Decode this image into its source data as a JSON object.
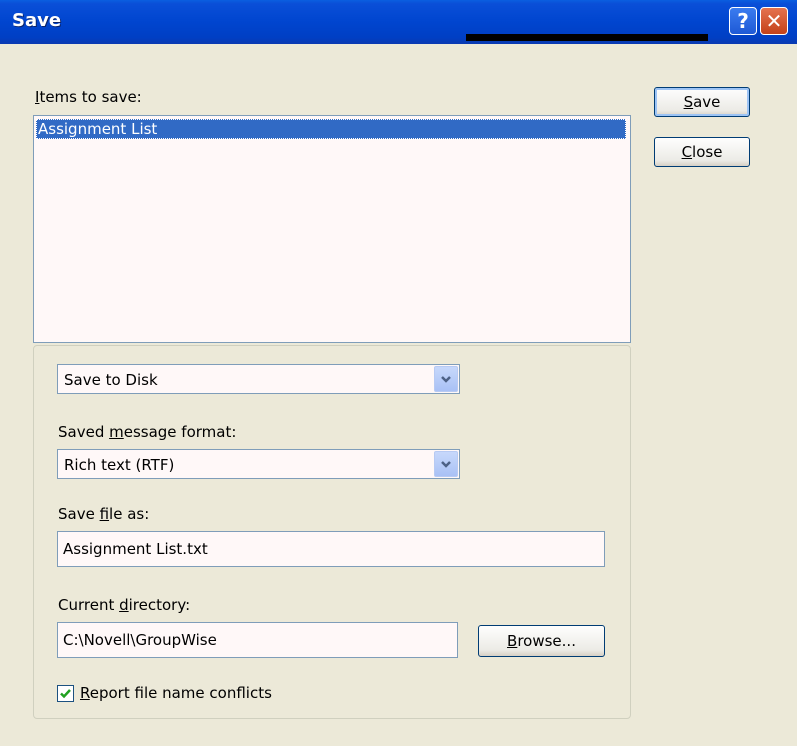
{
  "window": {
    "title": "Save",
    "help_glyph": "?",
    "close_glyph": "✕"
  },
  "items_label_prefix": "I",
  "items_label_rest": "tems to save:",
  "items": [
    "Assignment List"
  ],
  "buttons": {
    "save_underlined": "S",
    "save_rest": "ave",
    "close_underlined": "C",
    "close_rest": "lose",
    "browse_underlined": "B",
    "browse_rest": "rowse..."
  },
  "destination": {
    "selected": "Save to Disk"
  },
  "format": {
    "label_pre": "Saved ",
    "label_underlined": "m",
    "label_post": "essage format:",
    "selected": "Rich text (RTF)"
  },
  "filename": {
    "label_pre": "Save ",
    "label_underlined": "f",
    "label_post": "ile as:",
    "value": "Assignment List.txt"
  },
  "directory": {
    "label_pre": "Current ",
    "label_underlined": "d",
    "label_post": "irectory:",
    "value": "C:\\Novell\\GroupWise"
  },
  "conflicts": {
    "checked": true,
    "label_underlined": "R",
    "label_rest": "eport file name conflicts"
  },
  "icons": [
    "help-icon",
    "close-icon",
    "chevron-down-icon",
    "checkmark-icon"
  ],
  "colors": {
    "titlebar": "#0045cf",
    "selection": "#316ac5",
    "dialog_bg": "#ece9d8"
  }
}
